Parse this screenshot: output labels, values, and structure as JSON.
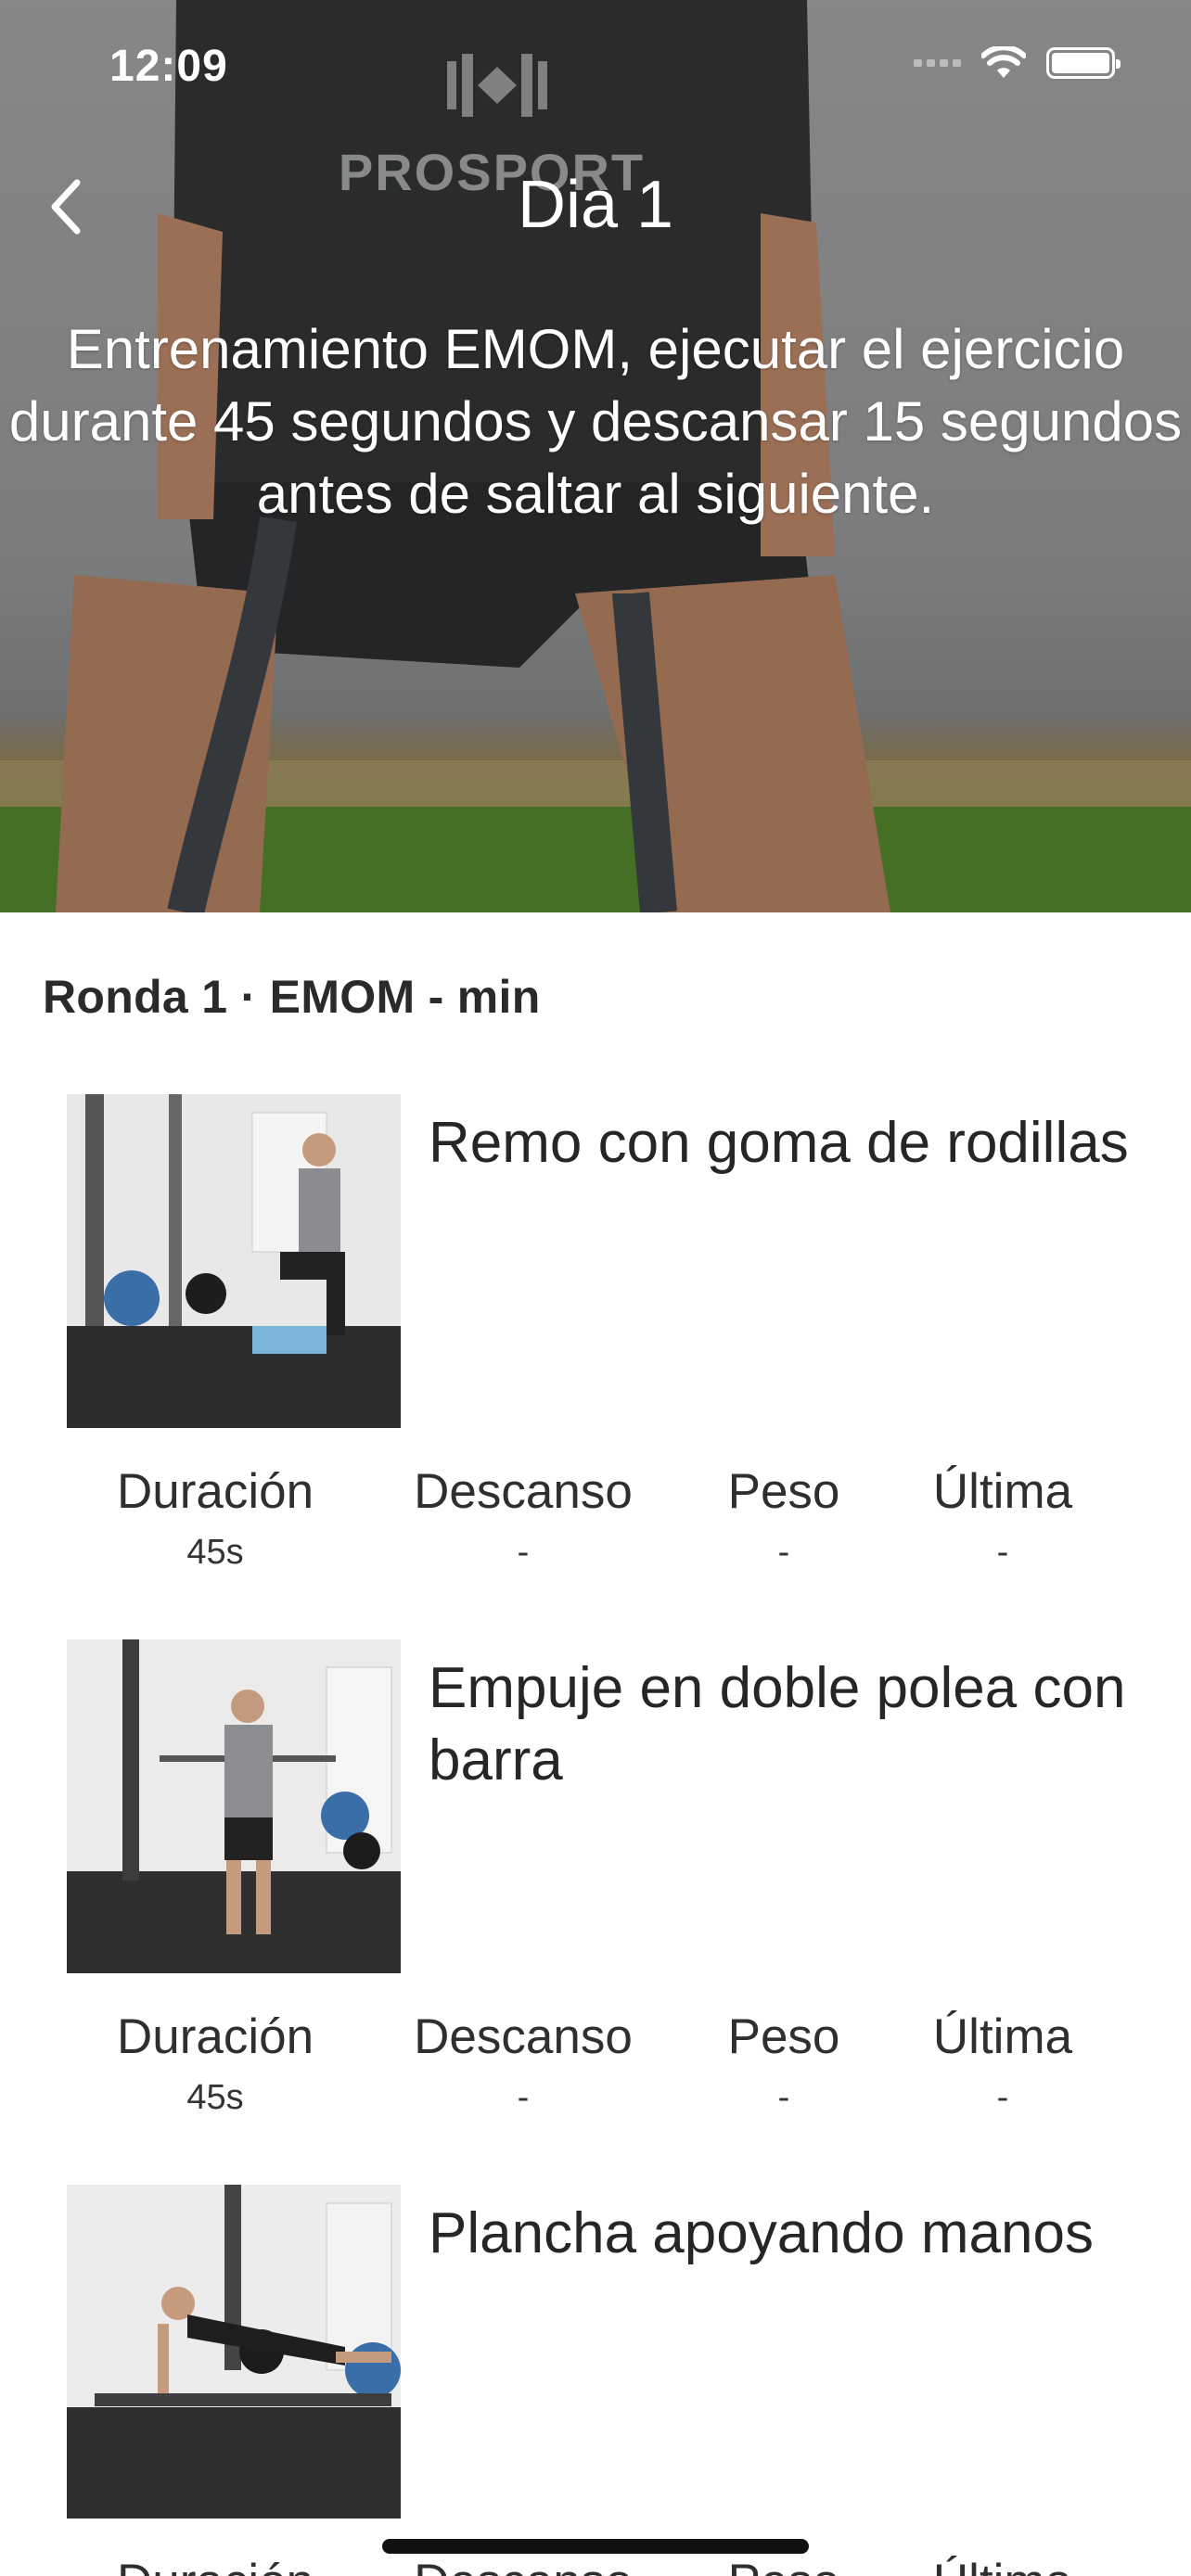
{
  "status_bar": {
    "time": "12:09"
  },
  "header": {
    "title": "Dia 1",
    "description": "Entrenamiento EMOM, ejecutar el ejercicio durante 45 segundos y descansar 15 segundos antes de saltar al siguiente.",
    "hero_shirt_text": "PROSPORT"
  },
  "round": {
    "title": "Ronda 1 · EMOM - min"
  },
  "exercises": [
    {
      "name": "Remo con goma de rodillas",
      "stats": [
        {
          "label": "Duración",
          "value": "45s"
        },
        {
          "label": "Descanso",
          "value": "-"
        },
        {
          "label": "Peso",
          "value": "-"
        },
        {
          "label": "Última",
          "value": "-"
        }
      ]
    },
    {
      "name": "Empuje en doble polea con barra",
      "stats": [
        {
          "label": "Duración",
          "value": "45s"
        },
        {
          "label": "Descanso",
          "value": "-"
        },
        {
          "label": "Peso",
          "value": "-"
        },
        {
          "label": "Última",
          "value": "-"
        }
      ]
    },
    {
      "name": "Plancha apoyando manos",
      "stats": [
        {
          "label": "Duración",
          "value": ""
        },
        {
          "label": "Descanso",
          "value": ""
        },
        {
          "label": "Peso",
          "value": ""
        },
        {
          "label": "Última",
          "value": ""
        }
      ]
    }
  ],
  "icons": {
    "back": "chevron-left-icon",
    "wifi": "wifi-icon",
    "battery": "battery-icon",
    "signal": "signal-icon"
  },
  "colors": {
    "hero_bg": "#8e8e90",
    "text": "#222222",
    "background": "#ffffff"
  }
}
